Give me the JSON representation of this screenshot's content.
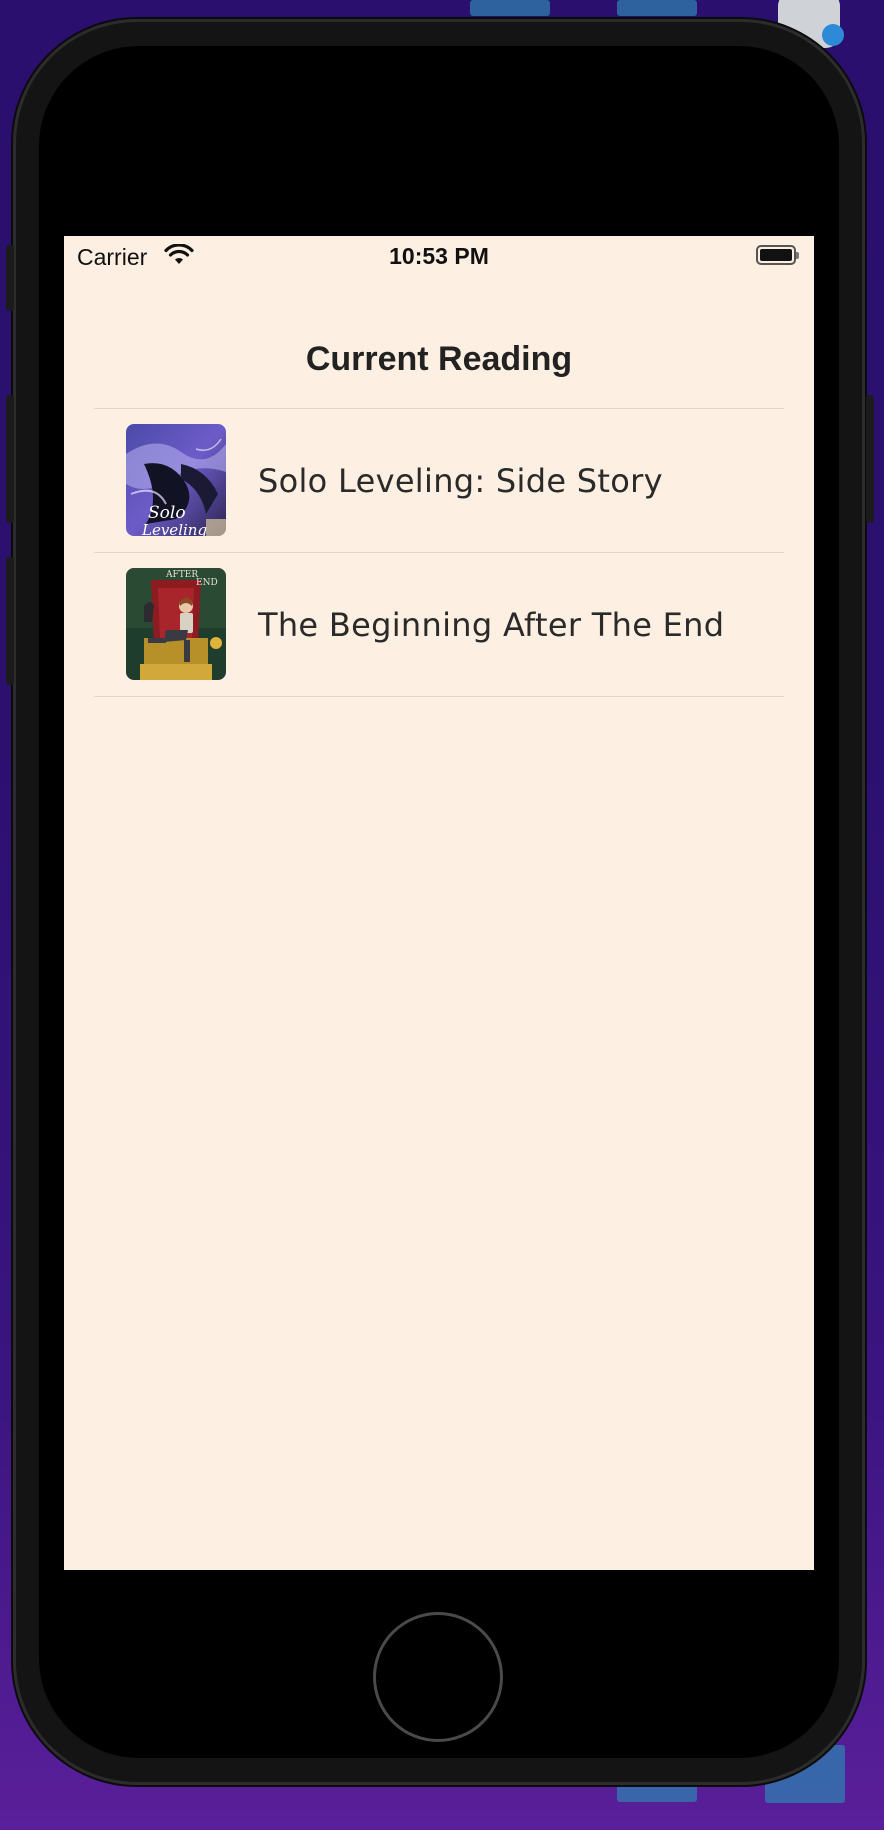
{
  "status_bar": {
    "carrier": "Carrier",
    "time": "10:53 PM"
  },
  "nav": {
    "title": "Current Reading"
  },
  "books": [
    {
      "title": "Solo Leveling: Side Story",
      "cover_text": "Solo Leveling"
    },
    {
      "title": "The Beginning After The End",
      "cover_text": "AFTER END"
    }
  ]
}
